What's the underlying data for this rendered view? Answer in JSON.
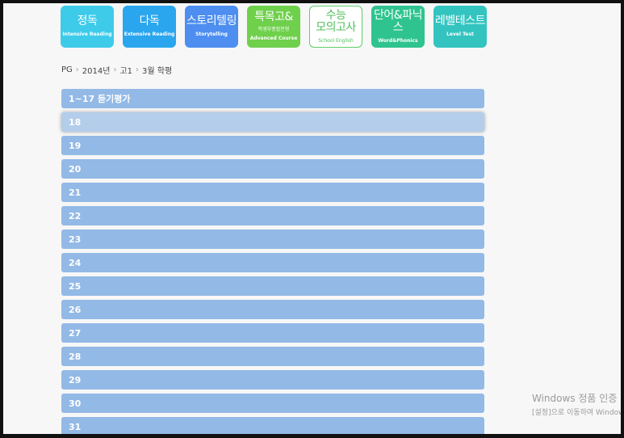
{
  "categories": [
    {
      "kr": "정독",
      "en": "Intensive Reading",
      "color": "#3ecbea"
    },
    {
      "kr": "다독",
      "en": "Extensive Reading",
      "color": "#2aa6ee"
    },
    {
      "kr": "스토리텔링",
      "en": "Storytelling",
      "color": "#4d8ef0"
    },
    {
      "kr": "특목고&",
      "sub": "학생부종합전형",
      "en": "Advanced Course",
      "color": "#6fd04c"
    },
    {
      "kr": "수능\n모의고사",
      "en": "School English",
      "color": "#ffffff",
      "outlined": true
    },
    {
      "kr": "단어&파닉스",
      "en": "Word&Phonics",
      "color": "#2fc48f"
    },
    {
      "kr": "레벨테스트",
      "en": "Level Test",
      "color": "#33c4c0"
    }
  ],
  "breadcrumb": [
    "PG",
    "2014년",
    "고1",
    "3월 학평"
  ],
  "rows": [
    "1~17 듣기평가",
    "18",
    "19",
    "20",
    "21",
    "22",
    "23",
    "24",
    "25",
    "26",
    "27",
    "28",
    "29",
    "30",
    "31"
  ],
  "hover_row": "18",
  "watermark": {
    "line1": "Windows 정품 인증",
    "line2": "[설정]으로 이동하여 Windows"
  }
}
